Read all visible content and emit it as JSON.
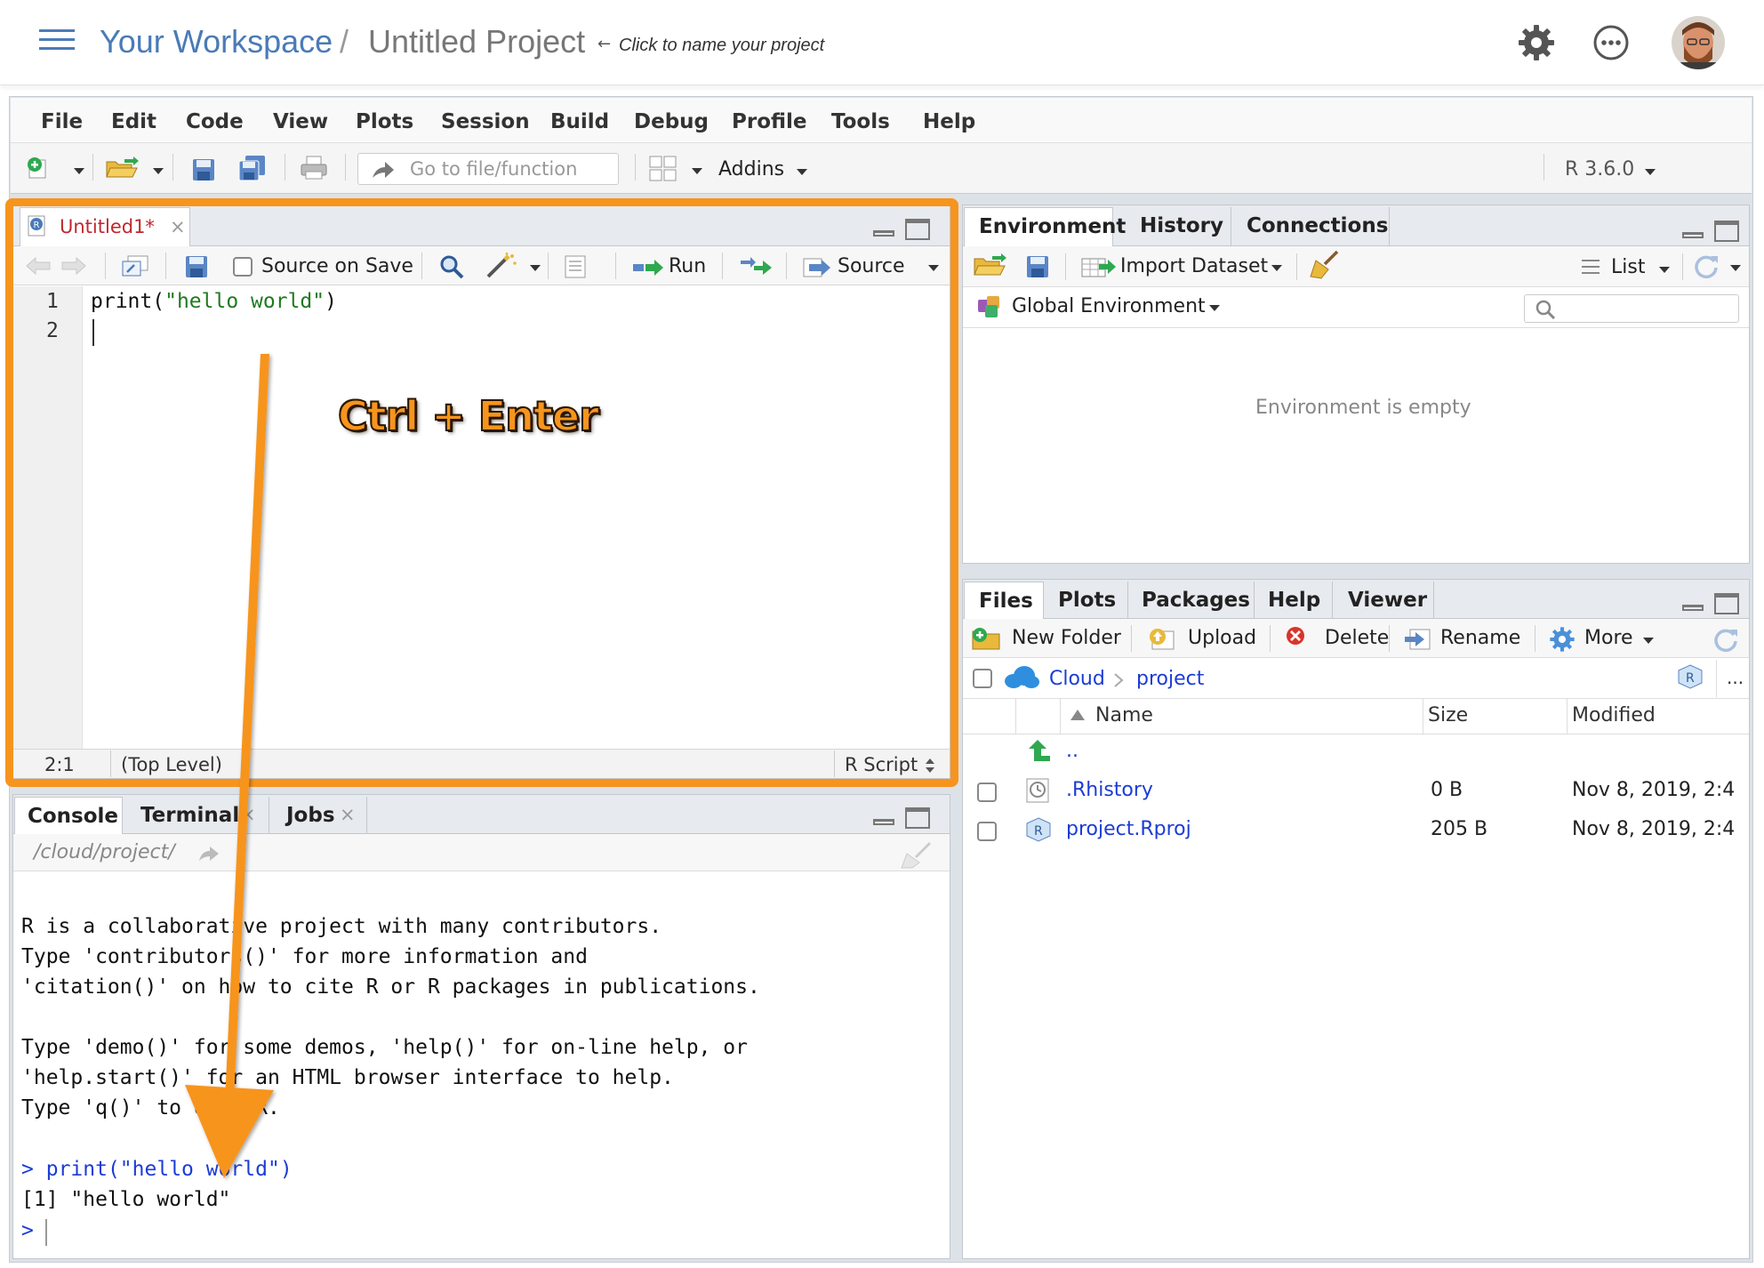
{
  "header": {
    "workspace": "Your Workspace",
    "separator": "/",
    "project": "Untitled Project",
    "hint_arrow": "←",
    "hint": "Click to name your project"
  },
  "menu": [
    "File",
    "Edit",
    "Code",
    "View",
    "Plots",
    "Session",
    "Build",
    "Debug",
    "Profile",
    "Tools",
    "Help"
  ],
  "toolbar": {
    "goto_placeholder": "Go to file/function",
    "addins": "Addins",
    "r_version": "R 3.6.0"
  },
  "editor": {
    "tab": "Untitled1*",
    "source_on_save": "Source on Save",
    "run": "Run",
    "source": "Source",
    "line_numbers": [
      "1",
      "2"
    ],
    "code_prefix": "print(",
    "code_string": "\"hello world\"",
    "code_suffix": ")",
    "status_pos": "2:1",
    "status_scope": "(Top Level)",
    "status_type": "R Script"
  },
  "annotation": {
    "shortcut": "Ctrl + Enter",
    "color": "#f7941d"
  },
  "console": {
    "tabs": [
      "Console",
      "Terminal",
      "Jobs"
    ],
    "path": "/cloud/project/",
    "lines": [
      "R is a collaborative project with many contributors.",
      "Type 'contributors()' for more information and",
      "'citation()' on how to cite R or R packages in publications.",
      "",
      "Type 'demo()' for some demos, 'help()' for on-line help, or",
      "'help.start()' for an HTML browser interface to help.",
      "Type 'q()' to quit R."
    ],
    "prompt": ">",
    "command": "print(\"hello world\")",
    "output": "[1] \"hello world\""
  },
  "environment": {
    "tabs": [
      "Environment",
      "History",
      "Connections"
    ],
    "import_dataset": "Import Dataset",
    "list": "List",
    "global_env": "Global Environment",
    "empty_msg": "Environment is empty"
  },
  "files": {
    "tabs": [
      "Files",
      "Plots",
      "Packages",
      "Help",
      "Viewer"
    ],
    "actions": {
      "new_folder": "New Folder",
      "upload": "Upload",
      "delete": "Delete",
      "rename": "Rename",
      "more": "More"
    },
    "breadcrumb": [
      "Cloud",
      "project"
    ],
    "more_dots": "...",
    "columns": {
      "name": "Name",
      "size": "Size",
      "modified": "Modified"
    },
    "parent": "..",
    "rows": [
      {
        "name": ".Rhistory",
        "size": "0 B",
        "modified": "Nov 8, 2019, 2:4"
      },
      {
        "name": "project.Rproj",
        "size": "205 B",
        "modified": "Nov 8, 2019, 2:4"
      }
    ]
  }
}
